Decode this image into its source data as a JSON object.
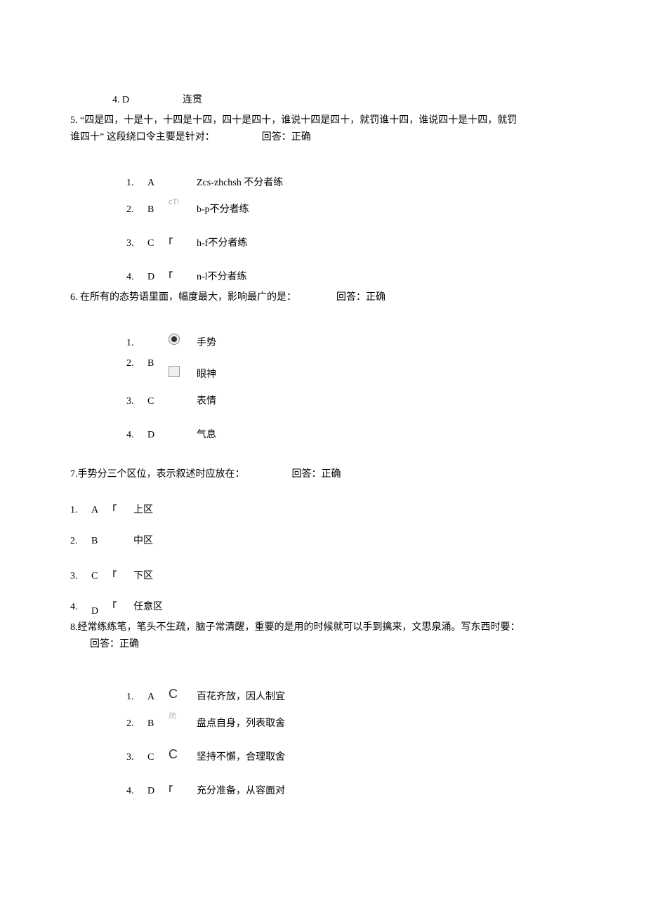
{
  "q4_opt": {
    "num": "4. D",
    "text": "连贯"
  },
  "q5": {
    "num": "5.",
    "text_a": "“四是四，十是十，十四是十四，四十是四十，谁说十四是四十，就罚谁十四，谁说四十是十四，就罚",
    "text_b": "谁四十” 这段绕口令主要是针对：",
    "feedback": "回答：正确",
    "opts": [
      {
        "n": "1.",
        "l": "A",
        "mark": "",
        "t": "Zcs-zhchsh 不分者练"
      },
      {
        "n": "2.",
        "l": "B",
        "mark": "cTl",
        "t": "b-p不分者练"
      },
      {
        "n": "3.",
        "l": "C",
        "mark": "r",
        "t": "h-f不分者练"
      },
      {
        "n": "4.",
        "l": "D",
        "mark": "r",
        "t": "n-l不分者练"
      }
    ]
  },
  "q6": {
    "num": "6.",
    "text": "在所有的态势语里面，幅度最大，影响最广的是：",
    "feedback": "回答：正确",
    "opts": [
      {
        "n": "1.",
        "l": "",
        "mark": "radio-dot",
        "t": "手势"
      },
      {
        "n": "2.",
        "l": "B",
        "mark": "radio-empty",
        "t": "眼神"
      },
      {
        "n": "3.",
        "l": "C",
        "mark": "",
        "t": "表情"
      },
      {
        "n": "4.",
        "l": "D",
        "mark": "",
        "t": "气息"
      }
    ]
  },
  "q7": {
    "num": "7.",
    "text": "手势分三个区位，表示叙述时应放在：",
    "feedback": "回答：正确",
    "opts": [
      {
        "n": "1.",
        "l": "A",
        "mark": "r",
        "t": "上区"
      },
      {
        "n": "2.",
        "l": "B",
        "mark": "",
        "t": "中区"
      },
      {
        "n": "3.",
        "l": "C",
        "mark": "r",
        "t": "下区"
      },
      {
        "n": "4.",
        "l": "D",
        "mark": "r",
        "t": "任意区"
      }
    ]
  },
  "q8": {
    "num": "8.",
    "text": "经常练练笔，笔头不生疏，脑子常清醒，重要的是用的时候就可以手到擒来，文思泉涌。写东西时要：",
    "feedback": "回答：正确",
    "opts": [
      {
        "n": "1.",
        "l": "A",
        "mark": "C",
        "t": "百花齐放，因人制宜"
      },
      {
        "n": "2.",
        "l": "B",
        "mark": "简",
        "t": "盘点自身，列表取舍"
      },
      {
        "n": "3.",
        "l": "C",
        "mark": "C",
        "t": "坚持不懈，合理取舍"
      },
      {
        "n": "4.",
        "l": "D",
        "mark": "r",
        "t": "充分准备，从容面对"
      }
    ]
  }
}
